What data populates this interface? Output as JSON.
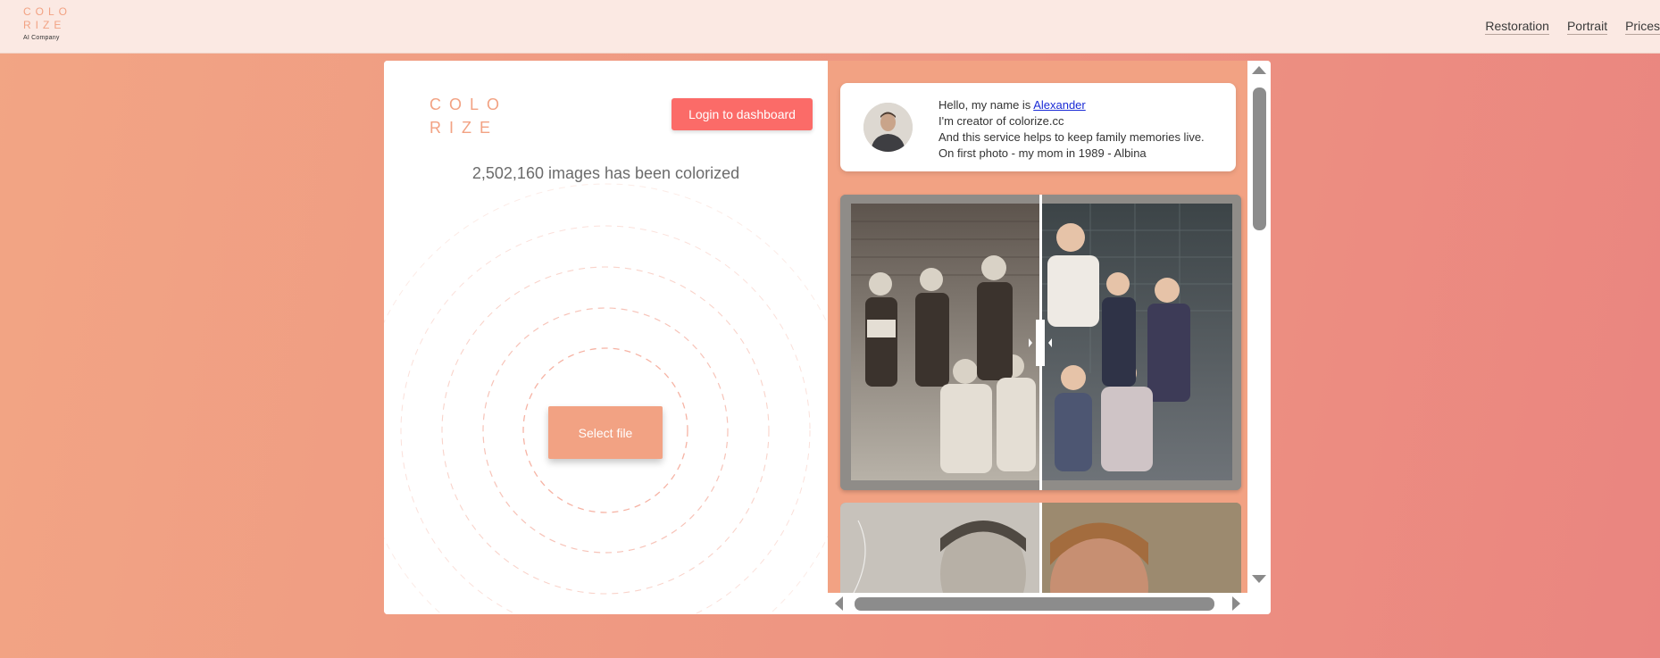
{
  "topbar": {
    "brand_line1": "COLO",
    "brand_line2": "RIZE",
    "brand_tagline": "AI Company",
    "nav": [
      "Restoration",
      "Portrait",
      "Prices"
    ]
  },
  "left": {
    "logo_line1": "COLO",
    "logo_line2": "RIZE",
    "login_label": "Login to dashboard",
    "counter_text": "2,502,160 images has been colorized",
    "select_label": "Select file"
  },
  "intro": {
    "line1_prefix": "Hello, my name is ",
    "author_link": "Alexander",
    "line2": "I'm creator of colorize.cc",
    "line3": "And this service helps to keep family memories live.",
    "line4": "On first photo - my mom in 1989 -  Albina"
  },
  "colors": {
    "accent": "#f2a283",
    "login_button": "#fb6b68",
    "background_start": "#f2a584",
    "background_end": "#ea8580",
    "topbar": "#fbe9e3"
  },
  "icons": {
    "scroll_up": "triangle-up",
    "scroll_down": "triangle-down",
    "scroll_left": "triangle-left",
    "scroll_right": "triangle-right",
    "slider": "compare-slider-handle"
  }
}
